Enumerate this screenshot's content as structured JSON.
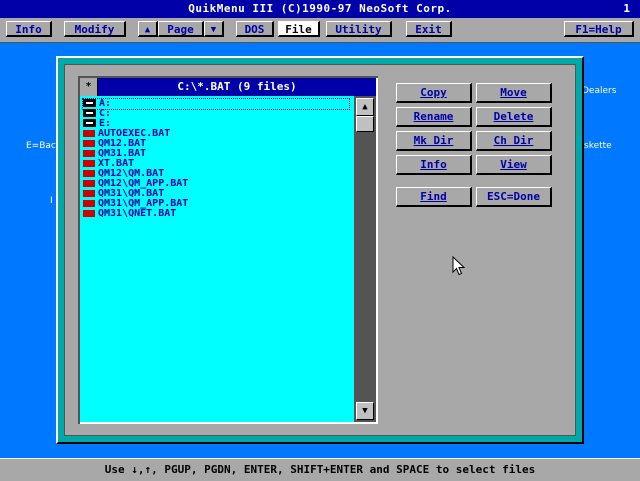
{
  "app": {
    "title": "QuikMenu III (C)1990-97 NeoSoft Corp.",
    "page_number": "1"
  },
  "menubar": {
    "info": "Info",
    "modify": "Modify",
    "page_up_icon": "up-triangle",
    "page": "Page",
    "page_down_icon": "down-triangle",
    "dos": "DOS",
    "file": "File",
    "utility": "Utility",
    "exit": "Exit",
    "help": "F1=Help"
  },
  "background": {
    "dealers": "Dealers",
    "e_back": "E=Bac",
    "diskette": "skette",
    "i_char": "I"
  },
  "dialog": {
    "sys_menu": "*",
    "list_title": "C:\\*.BAT (9 files)",
    "items": [
      {
        "label": "A:",
        "kind": "drive"
      },
      {
        "label": "C:",
        "kind": "drive"
      },
      {
        "label": "E:",
        "kind": "drive"
      },
      {
        "label": "AUTOEXEC.BAT",
        "kind": "file"
      },
      {
        "label": "QM12.BAT",
        "kind": "file"
      },
      {
        "label": "QM31.BAT",
        "kind": "file"
      },
      {
        "label": "XT.BAT",
        "kind": "file"
      },
      {
        "label": "QM12\\QM.BAT",
        "kind": "file"
      },
      {
        "label": "QM12\\QM_APP.BAT",
        "kind": "file"
      },
      {
        "label": "QM31\\QM.BAT",
        "kind": "file"
      },
      {
        "label": "QM31\\QM_APP.BAT",
        "kind": "file"
      },
      {
        "label": "QM31\\QNET.BAT",
        "kind": "file"
      }
    ],
    "buttons": {
      "copy": "Copy",
      "move": "Move",
      "rename": "Rename",
      "delete": "Delete",
      "mkdir": "Mk Dir",
      "chdir": "Ch Dir",
      "info": "Info",
      "view": "View",
      "find": "Find",
      "done": "ESC=Done"
    }
  },
  "status": {
    "text": "Use ↓,↑, PGUP, PGDN, ENTER, SHIFT+ENTER and SPACE to select files"
  },
  "colors": {
    "desktop": "#0078ff",
    "title_bg": "#0000a8",
    "list_bg": "#00ffff",
    "dialog_border": "#00a8a8",
    "panel": "#a8a8a8",
    "file_icon": "#d00000"
  }
}
